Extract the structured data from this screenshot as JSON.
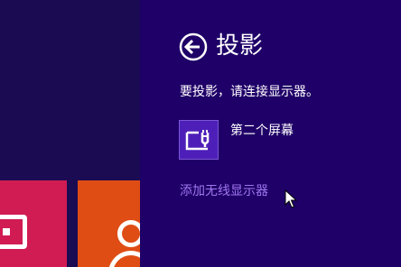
{
  "panel": {
    "title": "投影",
    "description": "要投影，请连接显示器。",
    "option": {
      "label": "第二个屏幕",
      "icon": "second-screen-icon"
    },
    "add_link": "添加无线显示器",
    "back_icon": "back-arrow-icon"
  },
  "colors": {
    "start_background": "#1b0b52",
    "panel_background": "#1f0068",
    "tile_left": "#d11c53",
    "tile_right": "#df4d14",
    "option_icon_bg": "#4e1fb8",
    "link": "#9f77ee"
  }
}
